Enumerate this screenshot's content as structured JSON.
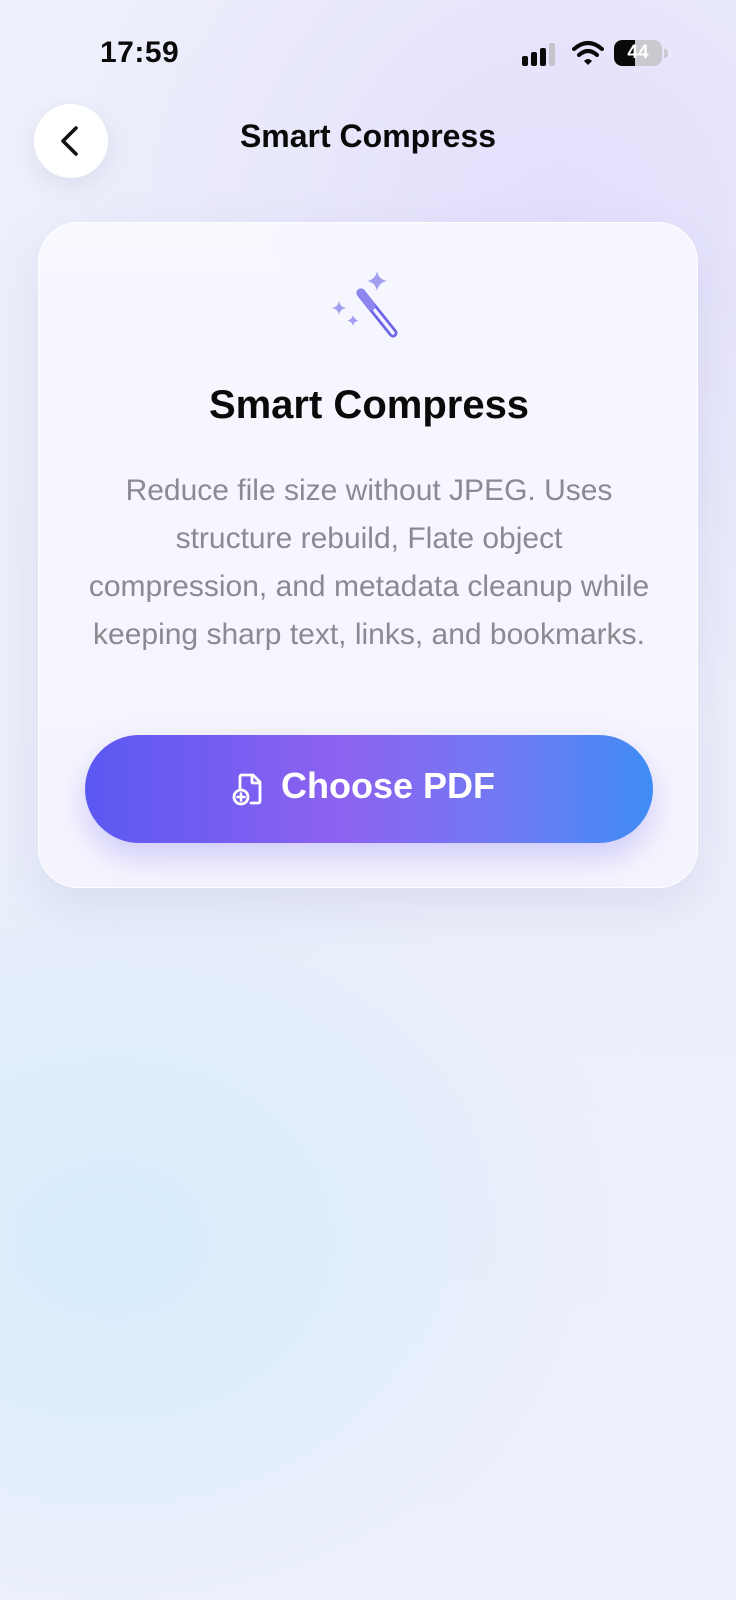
{
  "status_bar": {
    "time": "17:59",
    "battery_level": "44",
    "battery_fraction": 0.44,
    "signal_icon": "cellular-signal-icon",
    "wifi_icon": "wifi-icon"
  },
  "nav": {
    "back_icon": "chevron-left-icon",
    "title": "Smart Compress"
  },
  "card": {
    "icon": "magic-wand-icon",
    "title": "Smart Compress",
    "description": "Reduce file size without JPEG. Uses structure rebuild, Flate object compression, and metadata cleanup while keeping sharp text, links, and bookmarks.",
    "button": {
      "icon": "add-document-icon",
      "label": "Choose PDF"
    }
  },
  "colors": {
    "accent_purple": "#8d62f0",
    "accent_indigo": "#5b58f2",
    "accent_blue": "#3f8cf5",
    "wand_color": "#7a74e8"
  }
}
